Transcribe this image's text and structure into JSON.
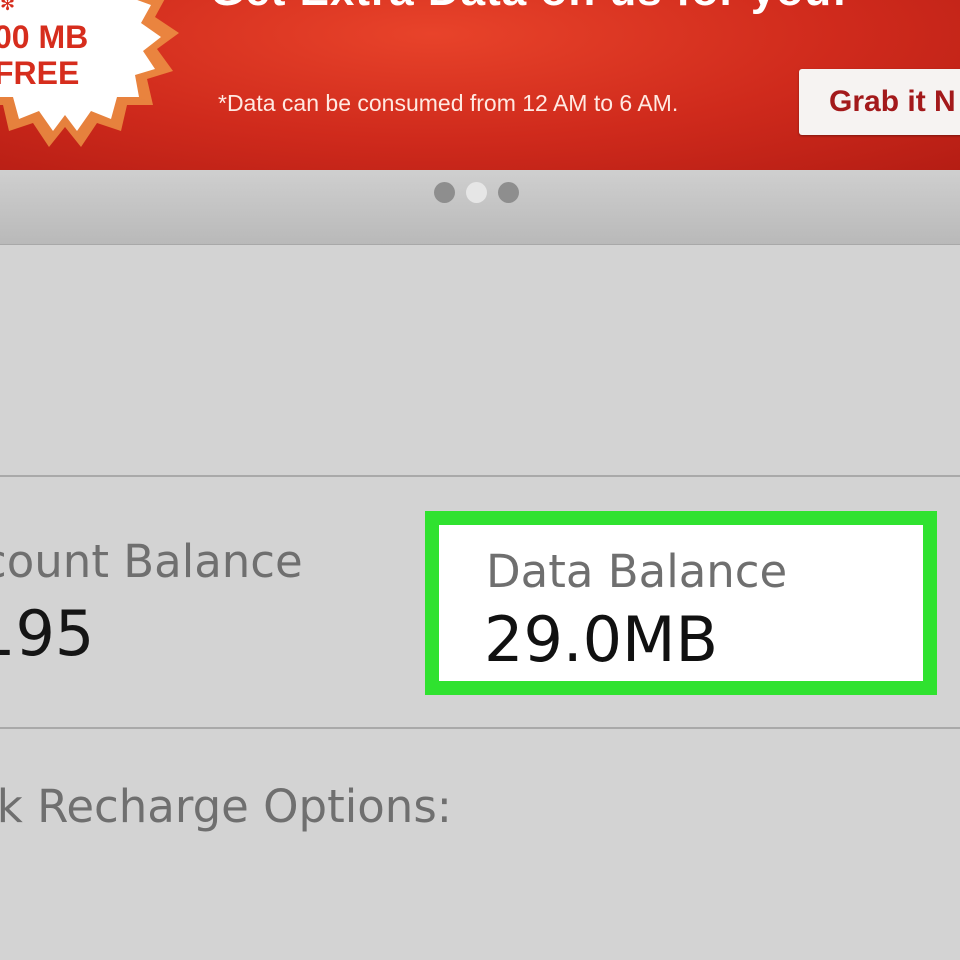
{
  "banner": {
    "headline": "Get Extra Data on us for you!",
    "burst_line1": "00 MB",
    "burst_line2": "FREE",
    "note": "*Data can be consumed from 12 AM to 6 AM.",
    "cta_label": "Grab it N",
    "background_color": "#cf2a1c",
    "cta_text_color": "#a3191b"
  },
  "carousel": {
    "page_count": 3,
    "active_index": 1
  },
  "balances": {
    "account_label": "count Balance",
    "account_value": "195",
    "data_label": "Data Balance",
    "data_value": "29.0MB",
    "highlight_color": "#2fe22f"
  },
  "recharge": {
    "label": "ck Recharge Options:"
  }
}
